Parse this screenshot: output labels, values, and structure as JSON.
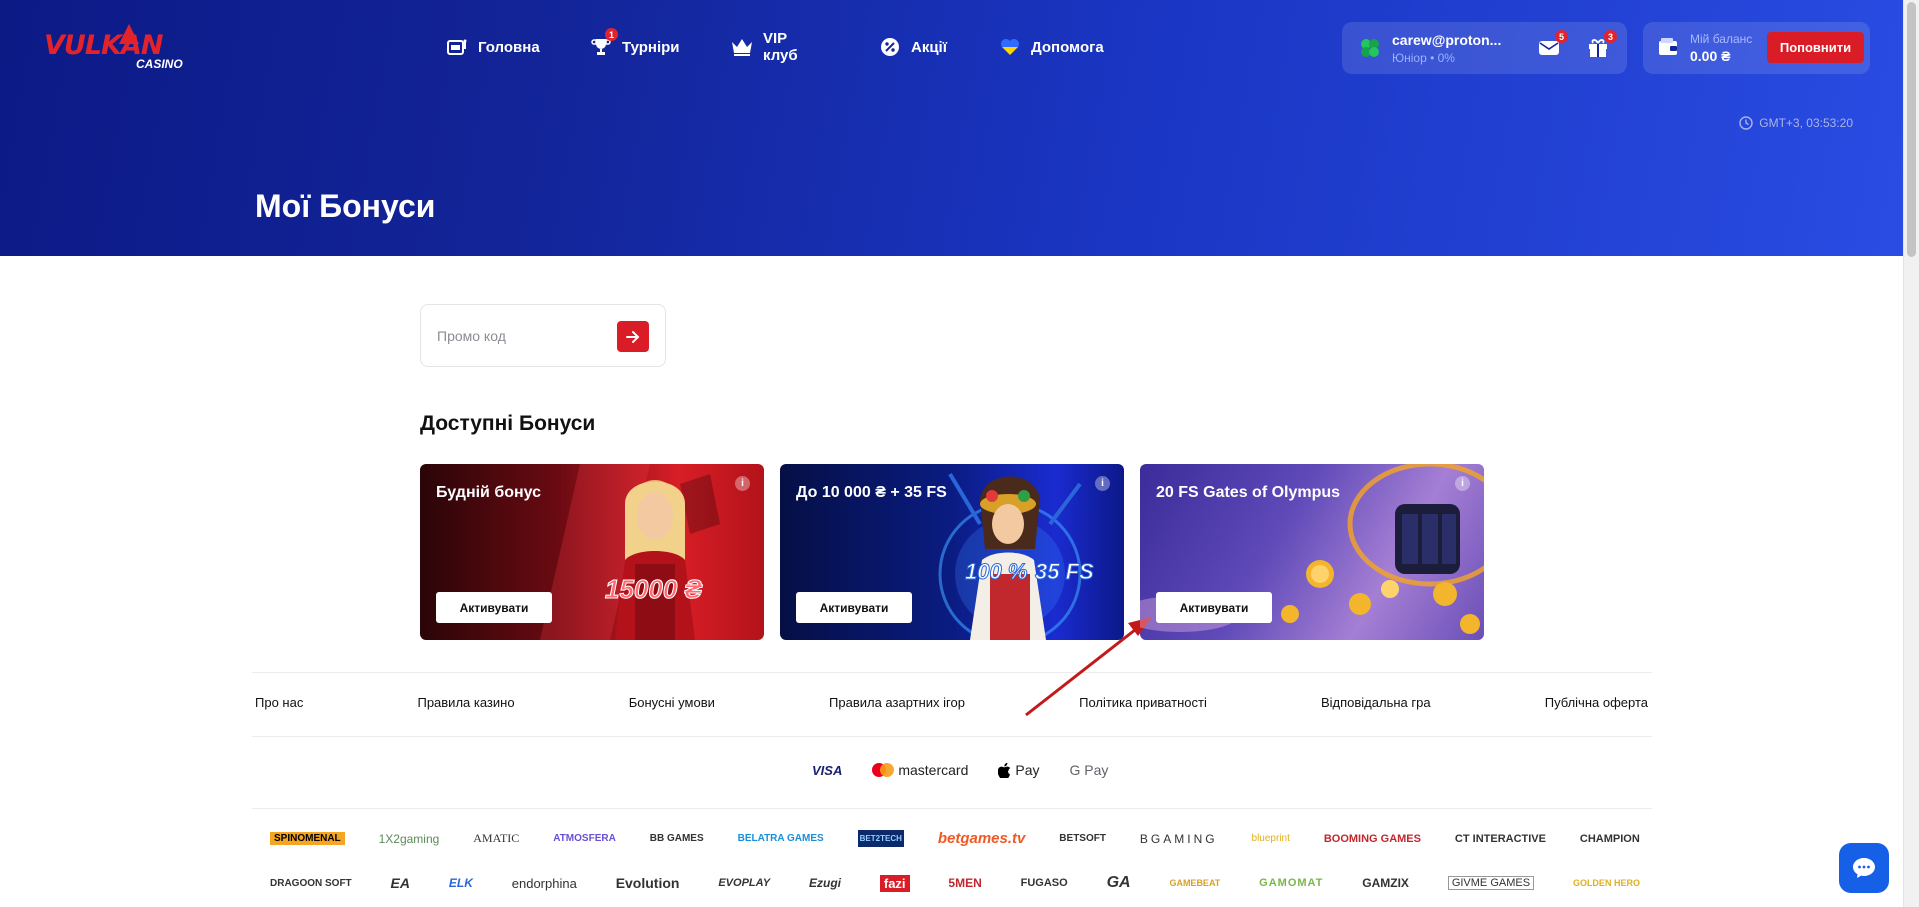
{
  "header": {
    "logo_text": "VULKAN",
    "logo_sub": "CASINO",
    "nav": [
      {
        "label": "Головна",
        "icon": "slot-machine-icon"
      },
      {
        "label": "Турніри",
        "icon": "trophy-icon",
        "badge": "1"
      },
      {
        "label": "VIP клуб",
        "icon": "crown-icon"
      },
      {
        "label": "Акції",
        "icon": "percent-badge-icon"
      },
      {
        "label": "Допомога",
        "icon": "ukraine-heart-icon"
      }
    ],
    "user": {
      "email": "carew@proton...",
      "level": "Юніор • 0%",
      "messages_badge": "5",
      "gifts_badge": "3"
    },
    "balance": {
      "label": "Мій баланс",
      "amount": "0.00 ₴",
      "topup_label": "Поповнити"
    },
    "time": "GMT+3, 03:53:20"
  },
  "page": {
    "title": "Мої Бонуси"
  },
  "promo": {
    "placeholder": "Промо код"
  },
  "bonuses": {
    "section_title": "Доступні Бонуси",
    "cards": [
      {
        "title": "Будній бонус",
        "button": "Активувати",
        "art_text": "15000 ₴"
      },
      {
        "title": "До 10 000 ₴ + 35 FS",
        "button": "Активувати",
        "art_text_1": "100 %",
        "art_text_2": "35 FS"
      },
      {
        "title": "20 FS Gates of Olympus",
        "button": "Активувати"
      }
    ]
  },
  "footer": {
    "links": [
      "Про нас",
      "Правила казино",
      "Бонусні умови",
      "Правила азартних ігор",
      "Політика приватності",
      "Відповідальна гра",
      "Публічна оферта"
    ],
    "payments": [
      "VISA",
      "mastercard",
      "Pay",
      "G Pay"
    ],
    "providers_row1": [
      "SPINOMENAL",
      "1X2gaming",
      "AMATIC",
      "ATMOSFERA",
      "BB GAMES",
      "BELATRA GAMES",
      "BET2TECH",
      "betgames.tv",
      "BETSOFT",
      "BGAMING",
      "blueprint",
      "BOOMING GAMES",
      "CT INTERACTIVE",
      "CHAMPION"
    ],
    "providers_row2": [
      "DRAGOON SOFT",
      "EA",
      "ELK",
      "endorphina",
      "Evolution",
      "EVOPLAY",
      "Ezugi",
      "fazi",
      "5MEN",
      "FUGASO",
      "GA",
      "GAMEBEAT",
      "GAMOMAT",
      "GAMZIX",
      "GIVME GAMES",
      "GOLDEN HERO"
    ]
  },
  "colors": {
    "accent_red": "#d91c25",
    "hero_blue": "#13259a",
    "chat_blue": "#1660e8"
  }
}
